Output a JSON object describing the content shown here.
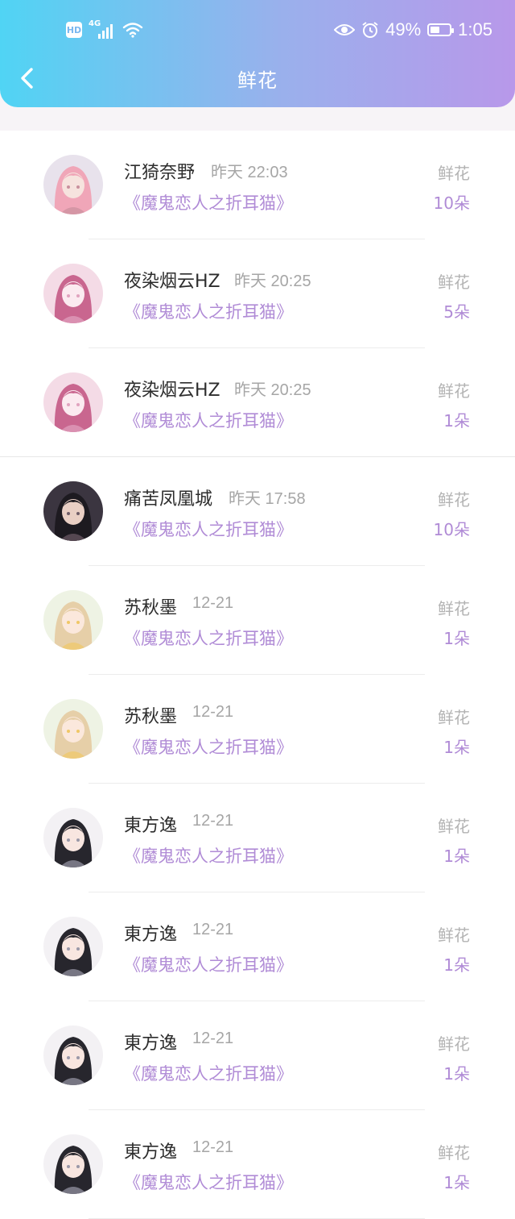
{
  "status_bar": {
    "hd": "HD",
    "network": "4G",
    "battery": "49%",
    "battery_level": 0.49,
    "time": "1:05"
  },
  "header": {
    "title": "鲜花"
  },
  "flower_label": "鲜花",
  "records": [
    {
      "name": "江猗奈野",
      "time": "昨天 22:03",
      "book": "《魔鬼恋人之折耳猫》",
      "count": "10朵",
      "avatar": "pink-hair-girl"
    },
    {
      "name": "夜染烟云HZ",
      "time": "昨天 20:25",
      "book": "《魔鬼恋人之折耳猫》",
      "count": "5朵",
      "avatar": "pink-sketch-girl"
    },
    {
      "name": "夜染烟云HZ",
      "time": "昨天 20:25",
      "book": "《魔鬼恋人之折耳猫》",
      "count": "1朵",
      "avatar": "pink-sketch-girl"
    },
    {
      "name": "痛苦凤凰城",
      "time": "昨天 17:58",
      "book": "《魔鬼恋人之折耳猫》",
      "count": "10朵",
      "avatar": "dark-hair-girl"
    },
    {
      "name": "苏秋墨",
      "time": "12-21",
      "book": "《魔鬼恋人之折耳猫》",
      "count": "1朵",
      "avatar": "blonde-girl"
    },
    {
      "name": "苏秋墨",
      "time": "12-21",
      "book": "《魔鬼恋人之折耳猫》",
      "count": "1朵",
      "avatar": "blonde-girl"
    },
    {
      "name": "東方逸",
      "time": "12-21",
      "book": "《魔鬼恋人之折耳猫》",
      "count": "1朵",
      "avatar": "black-hair-girl"
    },
    {
      "name": "東方逸",
      "time": "12-21",
      "book": "《魔鬼恋人之折耳猫》",
      "count": "1朵",
      "avatar": "black-hair-girl"
    },
    {
      "name": "東方逸",
      "time": "12-21",
      "book": "《魔鬼恋人之折耳猫》",
      "count": "1朵",
      "avatar": "black-hair-girl"
    },
    {
      "name": "東方逸",
      "time": "12-21",
      "book": "《魔鬼恋人之折耳猫》",
      "count": "1朵",
      "avatar": "black-hair-girl"
    }
  ],
  "colors": {
    "header_start": "#50d4f4",
    "header_end": "#b898ea",
    "accent": "#b08bd6"
  }
}
